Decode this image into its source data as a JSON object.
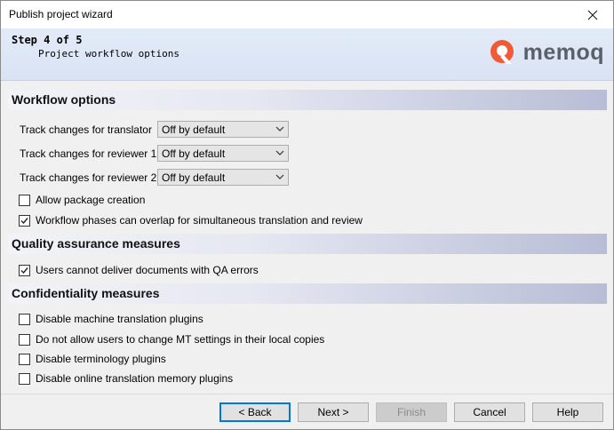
{
  "window": {
    "title": "Publish project wizard"
  },
  "header": {
    "step": "Step 4 of 5",
    "subtitle": "Project workflow options",
    "logo_text": "memoq",
    "logo_color": "#f15a36"
  },
  "workflow": {
    "heading": "Workflow options",
    "dropdowns": [
      {
        "label": "Track changes for translator",
        "value": "Off by default"
      },
      {
        "label": "Track changes for reviewer 1",
        "value": "Off by default"
      },
      {
        "label": "Track changes for reviewer 2",
        "value": "Off by default"
      }
    ],
    "checkboxes": [
      {
        "label": "Allow package creation",
        "checked": false
      },
      {
        "label": "Workflow phases can overlap for simultaneous translation and review",
        "checked": true
      }
    ]
  },
  "qa": {
    "heading": "Quality assurance measures",
    "checkboxes": [
      {
        "label": "Users cannot deliver documents with QA errors",
        "checked": true
      }
    ]
  },
  "confidentiality": {
    "heading": "Confidentiality measures",
    "checkboxes": [
      {
        "label": "Disable machine translation plugins",
        "checked": false
      },
      {
        "label": "Do not allow users to change MT settings in their local copies",
        "checked": false
      },
      {
        "label": "Disable terminology plugins",
        "checked": false
      },
      {
        "label": "Disable online translation memory plugins",
        "checked": false
      }
    ]
  },
  "footer": {
    "back": "< Back",
    "next": "Next >",
    "finish": "Finish",
    "cancel": "Cancel",
    "help": "Help"
  }
}
